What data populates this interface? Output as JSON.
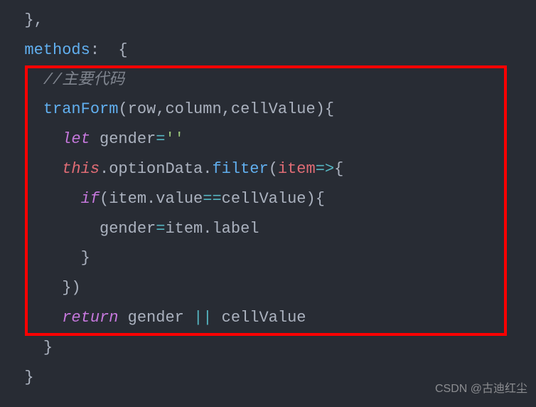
{
  "code": {
    "l0a": "  },",
    "l1_indent": "  ",
    "l1_methods": "methods",
    "l1_colon": ":",
    "l1_brace": "  {",
    "l2_indent": "    ",
    "l2_comment": "//主要代码",
    "l3_indent": "    ",
    "l3_name": "tranForm",
    "l3_open": "(",
    "l3_p1": "row",
    "l3_c1": ",",
    "l3_p2": "column",
    "l3_c2": ",",
    "l3_p3": "cellValue",
    "l3_close": ")",
    "l3_brace": "{",
    "l4_indent": "      ",
    "l4_let": "let",
    "l4_sp": " ",
    "l4_var": "gender",
    "l4_eq": "=",
    "l4_str": "''",
    "l5_indent": "      ",
    "l5_this": "this",
    "l5_dot1": ".",
    "l5_opt": "optionData",
    "l5_dot2": ".",
    "l5_filter": "filter",
    "l5_open": "(",
    "l5_item": "item",
    "l5_arrow": "=>",
    "l5_brace": "{",
    "l6_indent": "        ",
    "l6_if": "if",
    "l6_open": "(",
    "l6_item": "item",
    "l6_dot": ".",
    "l6_val": "value",
    "l6_eq": "==",
    "l6_cell": "cellValue",
    "l6_close": ")",
    "l6_brace": "{",
    "l7_indent": "          ",
    "l7_gender": "gender",
    "l7_eq": "=",
    "l7_item": "item",
    "l7_dot": ".",
    "l7_label": "label",
    "l8_indent": "        ",
    "l8_brace": "}",
    "l9_indent": "      ",
    "l9_brace": "}",
    "l9_close": ")",
    "l10_indent": "      ",
    "l10_return": "return",
    "l10_sp1": " ",
    "l10_gender": "gender",
    "l10_sp2": " ",
    "l10_or": "||",
    "l10_sp3": " ",
    "l10_cell": "cellValue",
    "l11_indent": "    ",
    "l11_brace": "}",
    "l12_indent": "  ",
    "l12_brace": "}"
  },
  "watermark": "CSDN @古迪红尘"
}
